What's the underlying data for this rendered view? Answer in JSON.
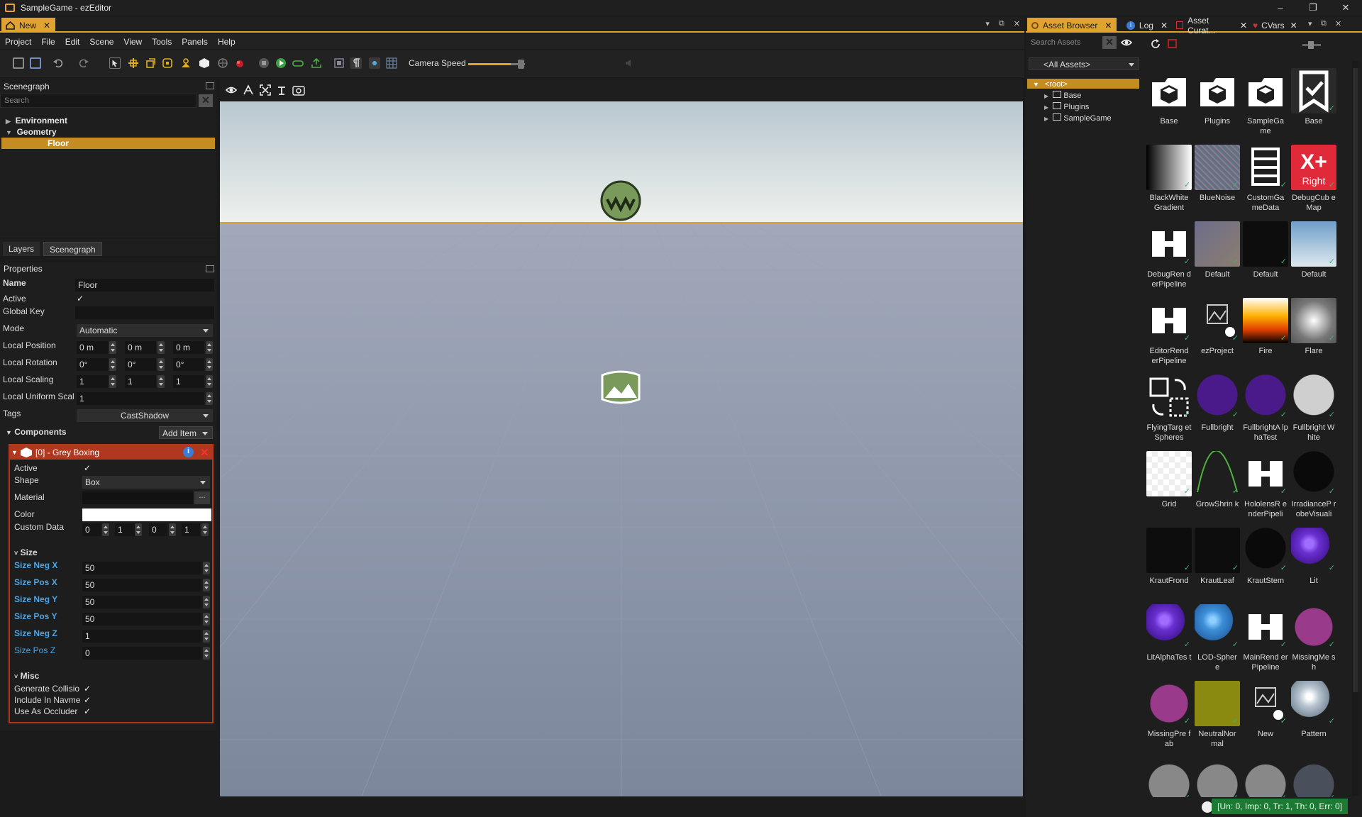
{
  "window": {
    "title": "SampleGame - ezEditor",
    "controls": [
      "–",
      "❐",
      "✕"
    ]
  },
  "doc_tab": {
    "label": "New",
    "close": "✕",
    "controls": [
      "▾",
      "⧉",
      "✕"
    ]
  },
  "menu": [
    "Project",
    "File",
    "Edit",
    "Scene",
    "View",
    "Tools",
    "Panels",
    "Help"
  ],
  "toolbar": {
    "camera_speed_label": "Camera Speed",
    "camera_speed": 0.75
  },
  "scenegraph": {
    "title": "Scenegraph",
    "search_placeholder": "Search",
    "items": [
      {
        "label": "Environment",
        "expanded": false
      },
      {
        "label": "Geometry",
        "expanded": true
      },
      {
        "label": "Floor",
        "selected": true
      }
    ]
  },
  "layer_tabs": [
    "Layers",
    "Scenegraph"
  ],
  "properties": {
    "title": "Properties",
    "name_label": "Name",
    "name_value": "Floor",
    "active_label": "Active",
    "active_check": "✓",
    "global_key_label": "Global Key",
    "global_key_value": "",
    "mode_label": "Mode",
    "mode_value": "Automatic",
    "local_position_label": "Local Position",
    "local_position": [
      "0 m",
      "0 m",
      "0 m"
    ],
    "local_rotation_label": "Local Rotation",
    "local_rotation": [
      "0°",
      "0°",
      "0°"
    ],
    "local_scaling_label": "Local Scaling",
    "local_scaling": [
      "1",
      "1",
      "1"
    ],
    "local_uniform_label": "Local Uniform Scal",
    "local_uniform_value": "1",
    "tags_label": "Tags",
    "tags_value": "CastShadow",
    "components_label": "Components",
    "add_item": "Add Item"
  },
  "component": {
    "title": "[0] - Grey Boxing",
    "active_label": "Active",
    "active_check": "✓",
    "shape_label": "Shape",
    "shape_value": "Box",
    "material_label": "Material",
    "material_value": "",
    "material_btn": "...",
    "color_label": "Color",
    "color_value": "#ffffff",
    "custom_data_label": "Custom Data",
    "custom_data": [
      "0",
      "1",
      "0",
      "1"
    ],
    "size_header": "Size",
    "sizes": [
      {
        "label": "Size Neg X",
        "value": "50"
      },
      {
        "label": "Size Pos X",
        "value": "50"
      },
      {
        "label": "Size Neg Y",
        "value": "50"
      },
      {
        "label": "Size Pos Y",
        "value": "50"
      },
      {
        "label": "Size Neg Z",
        "value": "1"
      },
      {
        "label": "Size Pos Z",
        "value": "0"
      }
    ],
    "misc_header": "Misc",
    "misc": [
      {
        "label": "Generate Collisio",
        "check": "✓"
      },
      {
        "label": "Include In Navme",
        "check": "✓"
      },
      {
        "label": "Use As Occluder",
        "check": "✓"
      }
    ]
  },
  "right_tabs": [
    {
      "label": "Asset Browser",
      "active": true
    },
    {
      "label": "Log"
    },
    {
      "label": "Asset Curat..."
    },
    {
      "label": "CVars"
    }
  ],
  "asset_browser": {
    "search_placeholder": "Search Assets",
    "filter_value": "<All Assets>",
    "tree": [
      {
        "label": "<root>",
        "selected": true
      },
      {
        "label": "Base"
      },
      {
        "label": "Plugins"
      },
      {
        "label": "SampleGame"
      }
    ],
    "assets": [
      {
        "label": "Base",
        "icon": "package-icon"
      },
      {
        "label": "Plugins",
        "icon": "package-icon"
      },
      {
        "label": "SampleGa me",
        "icon": "package-icon"
      },
      {
        "label": "Base",
        "icon": "bookmark-check-icon"
      },
      {
        "label": "BlackWhite Gradient",
        "icon": "gradient"
      },
      {
        "label": "BlueNoise",
        "icon": "noise"
      },
      {
        "label": "CustomGa meData",
        "icon": "data-icon"
      },
      {
        "label": "DebugCub eMap",
        "icon": "cubemap"
      },
      {
        "label": "DebugRen derPipeline",
        "icon": "pipeline-icon"
      },
      {
        "label": "Default",
        "icon": "texture"
      },
      {
        "label": "Default",
        "icon": "black"
      },
      {
        "label": "Default",
        "icon": "sky"
      },
      {
        "label": "EditorRend erPipeline",
        "icon": "pipeline-icon"
      },
      {
        "label": "ezProject",
        "icon": "project-icon"
      },
      {
        "label": "Fire",
        "icon": "fire"
      },
      {
        "label": "Flare",
        "icon": "flare"
      },
      {
        "label": "FlyingTarg etSpheres",
        "icon": "swap-icon"
      },
      {
        "label": "Fullbright",
        "icon": "ball-purple"
      },
      {
        "label": "FullbrightA lphaTest",
        "icon": "ball-purple"
      },
      {
        "label": "Fullbright White",
        "icon": "ball-white"
      },
      {
        "label": "Grid",
        "icon": "grid"
      },
      {
        "label": "GrowShrin k",
        "icon": "curve"
      },
      {
        "label": "HololensR enderPipeli",
        "icon": "pipeline-icon"
      },
      {
        "label": "IrradianceP robeVisuali",
        "icon": "ball-black"
      },
      {
        "label": "KrautFrond",
        "icon": "black"
      },
      {
        "label": "KrautLeaf",
        "icon": "black"
      },
      {
        "label": "KrautStem",
        "icon": "ball-black"
      },
      {
        "label": "Lit",
        "icon": "ball-violet"
      },
      {
        "label": "LitAlphaTes t",
        "icon": "ball-violet"
      },
      {
        "label": "LOD-Spher e",
        "icon": "ball-blue"
      },
      {
        "label": "MainRend erPipeline",
        "icon": "pipeline-icon"
      },
      {
        "label": "MissingMe sh",
        "icon": "cube-pink"
      },
      {
        "label": "MissingPre fab",
        "icon": "cube-pink"
      },
      {
        "label": "NeutralNor mal",
        "icon": "olive"
      },
      {
        "label": "New",
        "icon": "project-icon"
      },
      {
        "label": "Pattern",
        "icon": "ball-silver"
      },
      {
        "label": "",
        "icon": "ball-grey"
      },
      {
        "label": "",
        "icon": "ball-grey"
      },
      {
        "label": "",
        "icon": "ball-grey"
      },
      {
        "label": "",
        "icon": "ball-dark"
      }
    ]
  },
  "status": {
    "text": "[Un: 0, Imp: 0, Tr: 1, Th: 0, Err: 0]"
  }
}
